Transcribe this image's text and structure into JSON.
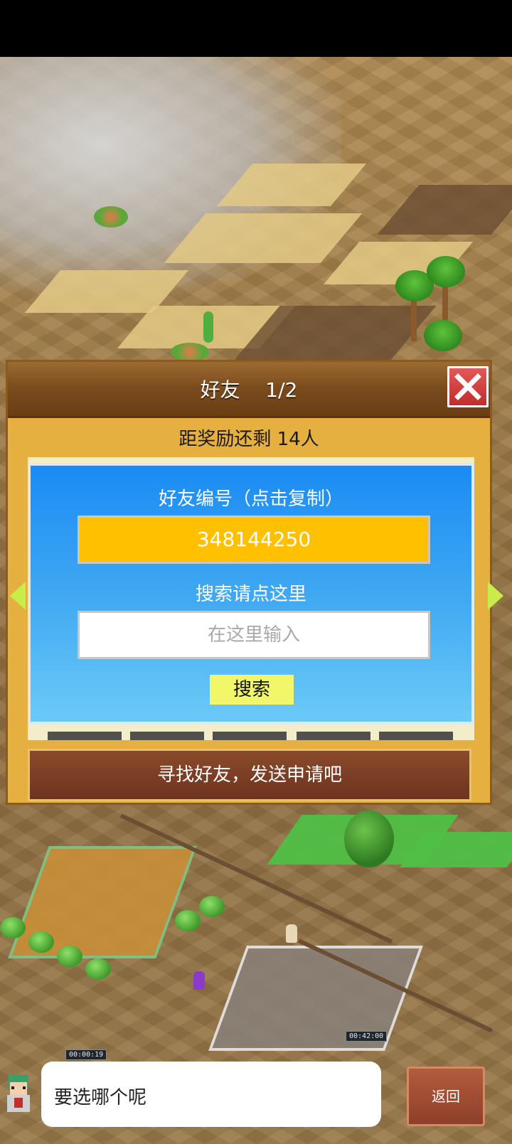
{
  "dialog": {
    "title": "好友",
    "page": "1/2",
    "reward_text": "距奖励还剩 14人",
    "friend_id_label": "好友编号（点击复制）",
    "friend_id": "348144250",
    "search_label": "搜索请点这里",
    "search_placeholder": "在这里输入",
    "search_button": "搜索",
    "banner": "寻找好友，发送申请吧"
  },
  "world": {
    "timers": [
      "00:00:19",
      "00:42:00"
    ]
  },
  "message": {
    "text": "要选哪个呢",
    "back_button": "返回"
  },
  "icons": {
    "close": "close-x-icon",
    "prev": "arrow-left-icon",
    "next": "arrow-right-icon"
  },
  "colors": {
    "panel_blue": "#1a8bf4",
    "id_yellow": "#ffc000",
    "search_button": "#f2f76a",
    "close_red": "#d83c3c"
  }
}
